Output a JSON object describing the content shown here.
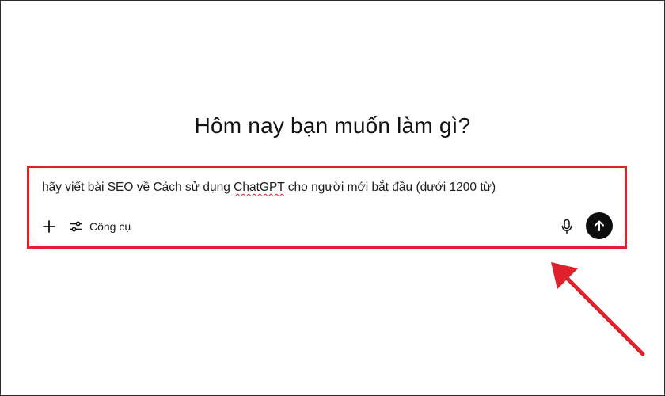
{
  "main": {
    "headline": "Hôm nay bạn muốn làm gì?"
  },
  "composer": {
    "prompt_before": "hãy viết bài SEO về Cách sử dụng ",
    "prompt_misspelled": "ChatGPT",
    "prompt_after": " cho người mới bắt đầu (dưới 1200 từ)",
    "tools_label": "Công cụ",
    "icons": {
      "add": "plus-icon",
      "tools": "sliders-icon",
      "mic": "microphone-icon",
      "send": "arrow-up-icon"
    }
  },
  "annotation": {
    "highlight_color": "#e0202a",
    "arrow_color": "#e0202a"
  },
  "colors": {
    "send_button": "#0d0d0d",
    "text": "#111111",
    "background": "#ffffff"
  }
}
